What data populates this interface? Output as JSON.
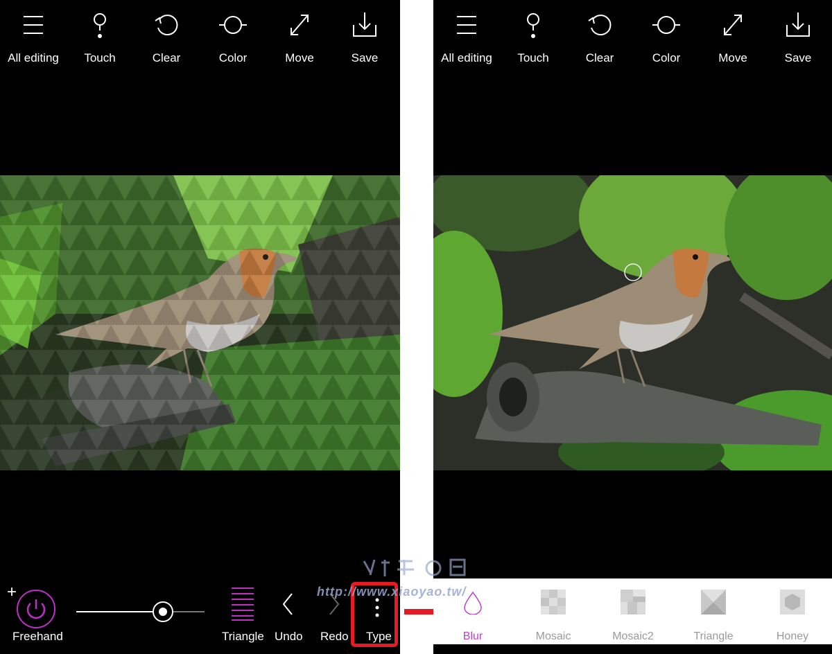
{
  "toolbar": {
    "items": [
      {
        "label": "All editing",
        "icon": "menu-icon"
      },
      {
        "label": "Touch",
        "icon": "touch-icon"
      },
      {
        "label": "Clear",
        "icon": "undo-circle-icon"
      },
      {
        "label": "Color",
        "icon": "color-circle-icon"
      },
      {
        "label": "Move",
        "icon": "move-arrows-icon"
      },
      {
        "label": "Save",
        "icon": "download-tray-icon"
      }
    ]
  },
  "left_bottom": {
    "mode_label": "Freehand",
    "plus": "+",
    "shape_label": "Triangle",
    "undo_label": "Undo",
    "redo_label": "Redo",
    "type_label": "Type",
    "slider_value": 0.67
  },
  "type_options": [
    {
      "label": "Blur",
      "selected": true
    },
    {
      "label": "Mosaic",
      "selected": false
    },
    {
      "label": "Mosaic2",
      "selected": false
    },
    {
      "label": "Triangle",
      "selected": false
    },
    {
      "label": "Honey",
      "selected": false
    }
  ],
  "colors": {
    "accent": "#c02ec8",
    "highlight": "#e51c23",
    "background": "#000000"
  }
}
